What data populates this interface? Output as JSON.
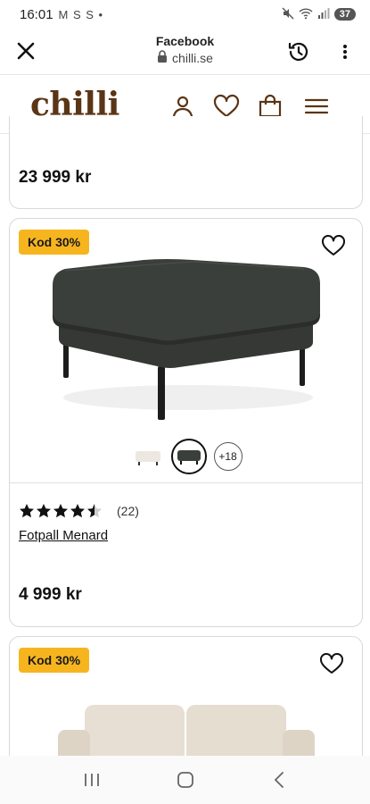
{
  "status_bar": {
    "time": "16:01",
    "left_icons": "M S S •",
    "battery": "37"
  },
  "browser": {
    "title": "Facebook",
    "url": "chilli.se"
  },
  "site": {
    "logo": "chilli",
    "brand_color": "#5a3516"
  },
  "products": {
    "previous": {
      "price": "23 999 kr"
    },
    "current": {
      "badge": "Kod 30%",
      "rating_value": 4.5,
      "rating_max": 5,
      "review_count": "(22)",
      "name": "Fotpall Menard",
      "more_colors": "+18",
      "price": "4 999 kr"
    },
    "next": {
      "badge": "Kod 30%"
    }
  },
  "colors": {
    "badge": "#f6b51f",
    "product_fabric": "#3b3f3b"
  }
}
